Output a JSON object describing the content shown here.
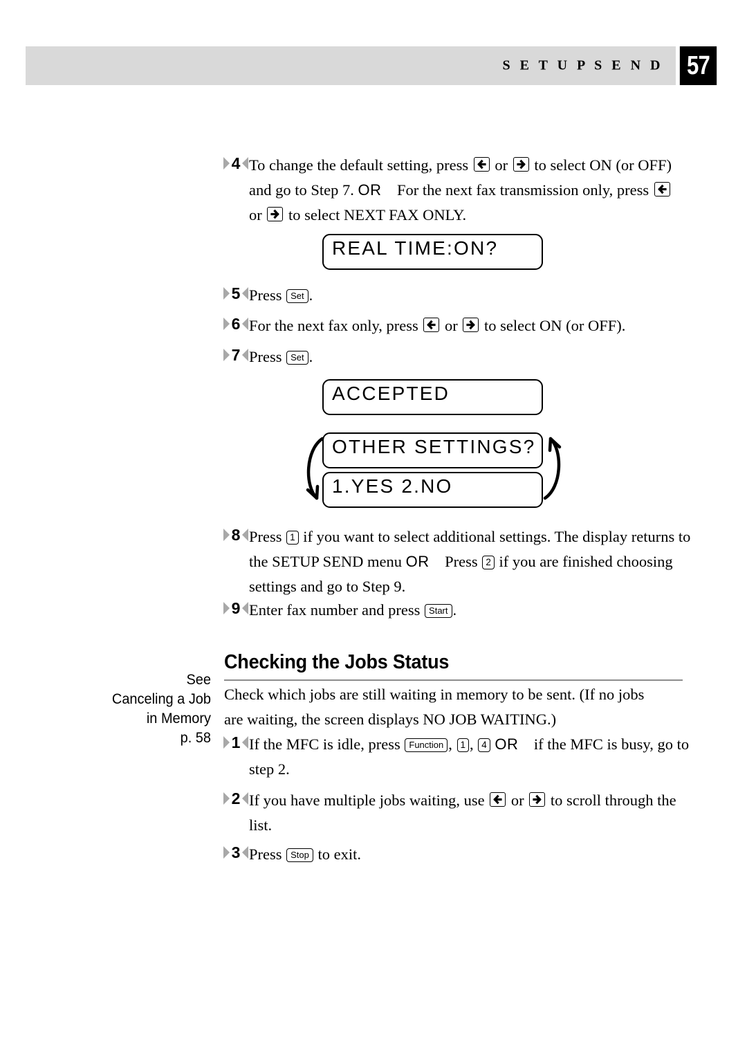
{
  "header": {
    "section_label": "S E T U P   S E N D",
    "page_number": "57",
    "band_color": "#d9d9d9",
    "badge_color": "#000000"
  },
  "steps_setup_send": [
    {
      "number": "4",
      "parts": [
        {
          "type": "text",
          "value": "To change the default setting, press "
        },
        {
          "type": "key-arrow",
          "value": "left-arrow-key"
        },
        {
          "type": "text",
          "value": " or "
        },
        {
          "type": "key-arrow",
          "value": "right-arrow-key"
        },
        {
          "type": "text",
          "value": " to select ON (or OFF) and go to Step 7. "
        },
        {
          "type": "or",
          "value": "OR"
        },
        {
          "type": "text",
          "value": "    For the next fax transmission only, press "
        },
        {
          "type": "key-arrow",
          "value": "left-arrow-key"
        },
        {
          "type": "text",
          "value": " or "
        },
        {
          "type": "key-arrow",
          "value": "right-arrow-key"
        },
        {
          "type": "text",
          "value": " to select NEXT FAX ONLY."
        }
      ]
    },
    {
      "number": "5",
      "parts": [
        {
          "type": "text",
          "value": "Press "
        },
        {
          "type": "key",
          "value": "Set"
        },
        {
          "type": "text",
          "value": "."
        }
      ]
    },
    {
      "number": "6",
      "parts": [
        {
          "type": "text",
          "value": "For the next fax only, press "
        },
        {
          "type": "key-arrow",
          "value": "left-arrow-key"
        },
        {
          "type": "text",
          "value": " or "
        },
        {
          "type": "key-arrow",
          "value": "right-arrow-key"
        },
        {
          "type": "text",
          "value": " to select ON (or OFF)."
        }
      ]
    },
    {
      "number": "7",
      "parts": [
        {
          "type": "text",
          "value": "Press "
        },
        {
          "type": "key",
          "value": "Set"
        },
        {
          "type": "text",
          "value": "."
        }
      ]
    },
    {
      "number": "8",
      "parts": [
        {
          "type": "text",
          "value": "Press "
        },
        {
          "type": "key",
          "value": "1"
        },
        {
          "type": "text",
          "value": " if you want to select additional settings. The display returns to the SETUP SEND menu "
        },
        {
          "type": "or",
          "value": "OR"
        },
        {
          "type": "text",
          "value": "    Press "
        },
        {
          "type": "key",
          "value": "2"
        },
        {
          "type": "text",
          "value": " if you are finished choosing settings and go to Step 9."
        }
      ]
    },
    {
      "number": "9",
      "parts": [
        {
          "type": "text",
          "value": "Enter fax number and press "
        },
        {
          "type": "key",
          "value": "Start"
        },
        {
          "type": "text",
          "value": "."
        }
      ]
    }
  ],
  "lcd_displays": [
    {
      "id": "real-time",
      "text": "REAL TIME:ON?"
    },
    {
      "id": "accepted",
      "text": "ACCEPTED"
    },
    {
      "id": "other-settings",
      "text": "OTHER SETTINGS?"
    },
    {
      "id": "yes-no",
      "text": "1.YES 2.NO"
    }
  ],
  "section": {
    "heading": "Checking the Jobs Status",
    "intro": "Check which jobs are still waiting in memory to be sent. (If no jobs are waiting, the screen displays NO JOB WAITING.)"
  },
  "margin_note": {
    "line1": "See",
    "line2": "Canceling a Job",
    "line3": "in Memory",
    "line4": "p. 58"
  },
  "steps_jobs_status": [
    {
      "number": "1",
      "parts": [
        {
          "type": "text",
          "value": "If the MFC is idle, press "
        },
        {
          "type": "key",
          "value": "Function"
        },
        {
          "type": "text",
          "value": ", "
        },
        {
          "type": "key",
          "value": "1"
        },
        {
          "type": "text",
          "value": ", "
        },
        {
          "type": "key",
          "value": "4"
        },
        {
          "type": "text",
          "value": " "
        },
        {
          "type": "or",
          "value": "OR"
        },
        {
          "type": "text",
          "value": "    if the MFC is busy, go to step 2."
        }
      ]
    },
    {
      "number": "2",
      "parts": [
        {
          "type": "text",
          "value": "If you have multiple jobs waiting, use "
        },
        {
          "type": "key-arrow",
          "value": "left-arrow-key"
        },
        {
          "type": "text",
          "value": " or "
        },
        {
          "type": "key-arrow",
          "value": "right-arrow-key"
        },
        {
          "type": "text",
          "value": " to scroll through the list."
        }
      ]
    },
    {
      "number": "3",
      "parts": [
        {
          "type": "text",
          "value": "Press "
        },
        {
          "type": "key",
          "value": "Stop"
        },
        {
          "type": "text",
          "value": " to exit."
        }
      ]
    }
  ]
}
